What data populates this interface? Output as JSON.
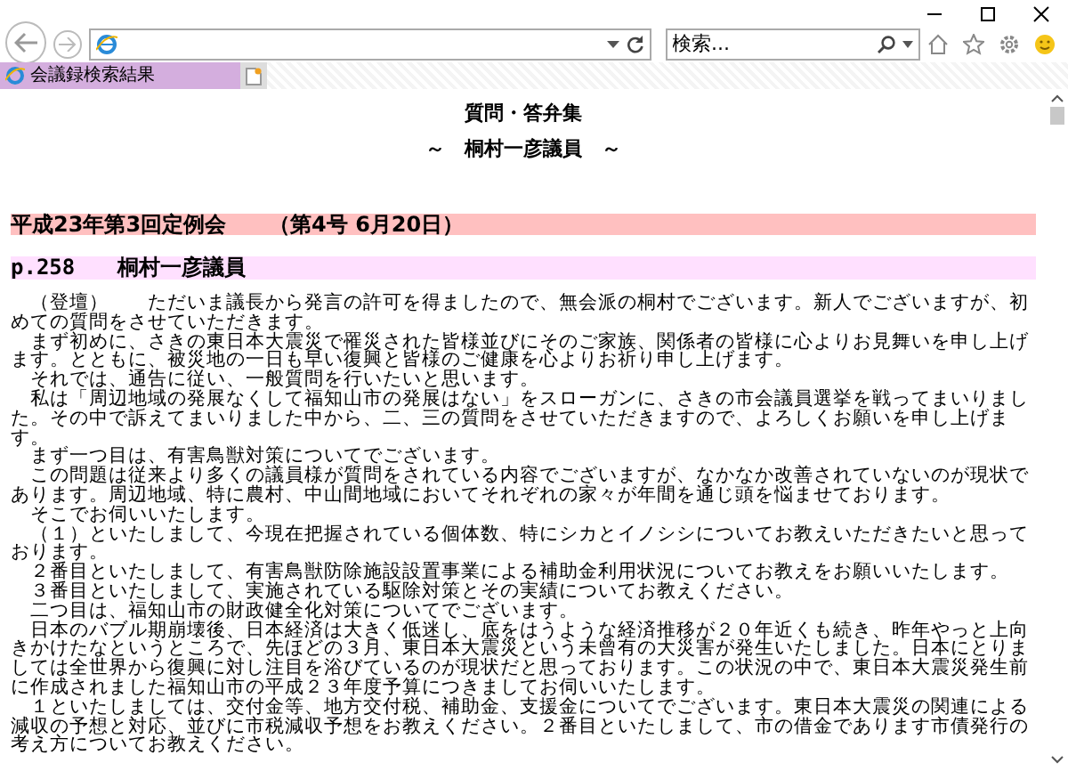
{
  "browser": {
    "search": {
      "placeholder": "検索..."
    },
    "tabs": [
      {
        "label": "会議録検索結果",
        "selected": true
      }
    ]
  },
  "page": {
    "title": "質問・答弁集",
    "subtitle": "～　桐村一彦議員　～",
    "session": "平成23年第3回定例会　　（第4号 6月20日）",
    "member": "p.258　　桐村一彦議員",
    "paragraphs": [
      "　（登壇）　　ただいま議長から発言の許可を得ましたので、無会派の桐村でございます。新人でございますが、初めての質問をさせていただきます。",
      "　まず初めに、さきの東日本大震災で罹災された皆様並びにそのご家族、関係者の皆様に心よりお見舞いを申し上げます。とともに、被災地の一日も早い復興と皆様のご健康を心よりお祈り申し上げます。",
      "　それでは、通告に従い、一般質問を行いたいと思います。",
      "　私は「周辺地域の発展なくして福知山市の発展はない」をスローガンに、さきの市会議員選挙を戦ってまいりました。その中で訴えてまいりました中から、二、三の質問をさせていただきますので、よろしくお願いを申し上げます。",
      "　まず一つ目は、有害鳥獣対策についてでございます。",
      "　この問題は従来より多くの議員様が質問をされている内容でございますが、なかなか改善されていないのが現状であります。周辺地域、特に農村、中山間地域においてそれぞれの家々が年間を通じ頭を悩ませております。",
      "　そこでお伺いいたします。",
      "　（１）といたしまして、今現在把握されている個体数、特にシカとイノシシについてお教えいただきたいと思っております。",
      "　２番目といたしまして、有害鳥獣防除施設設置事業による補助金利用状況についてお教えをお願いいたします。",
      "　３番目といたしまして、実施されている駆除対策とその実績についてお教えください。",
      "　二つ目は、福知山市の財政健全化対策についてでございます。",
      "　日本のバブル期崩壊後、日本経済は大きく低迷し、底をはうような経済推移が２０年近くも続き、昨年やっと上向きかけたなというところで、先ほどの３月、東日本大震災という未曾有の大災害が発生いたしました。日本にとりましては全世界から復興に対し注目を浴びているのが現状だと思っております。この状況の中で、東日本大震災発生前に作成されました福知山市の平成２３年度予算につきましてお伺いいたします。",
      "　１といたしましては、交付金等、地方交付税、補助金、支援金についてでございます。東日本大震災の関連による減収の予想と対応、並びに市税減収予想をお教えください。２番目といたしまして、市の借金であります市債発行の考え方についてお教えください。"
    ]
  }
}
